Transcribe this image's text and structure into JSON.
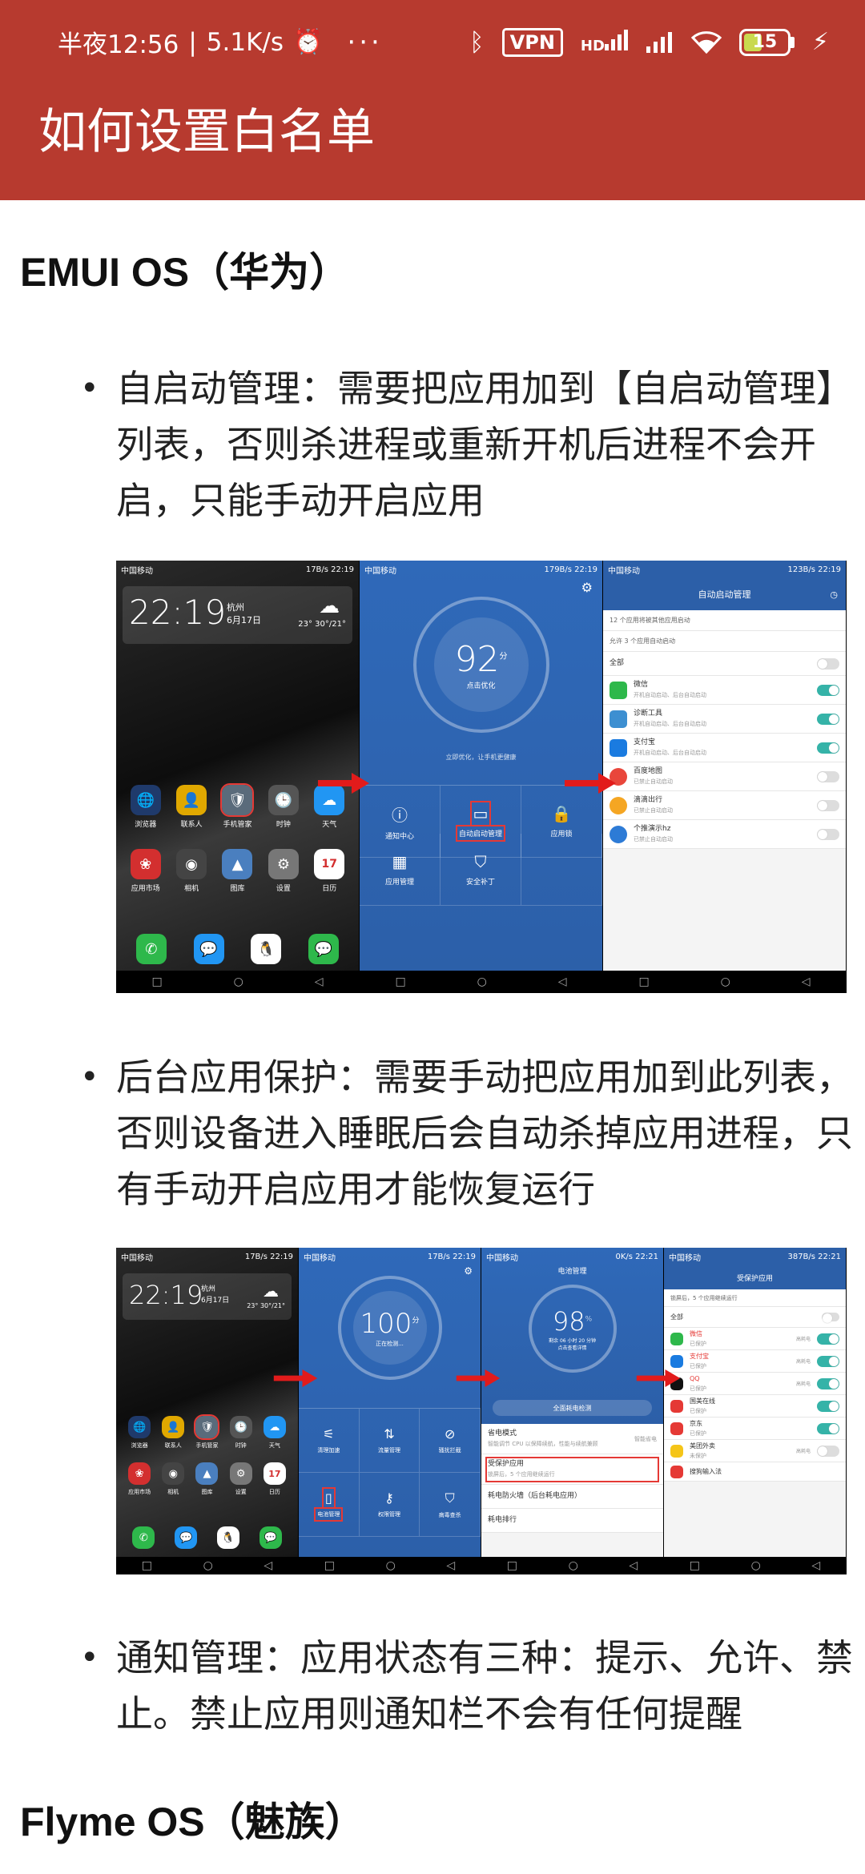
{
  "status_bar": {
    "time": "半夜12:56",
    "speed": "5.1K/s",
    "more": "···",
    "vpn": "VPN",
    "network": "HD",
    "battery": "15"
  },
  "app_bar": {
    "title": "如何设置白名单"
  },
  "sections": [
    {
      "heading": "EMUI OS（华为）"
    },
    {
      "heading": "Flyme OS（魅族）"
    }
  ],
  "bullets": [
    "自启动管理：需要把应用加到【自启动管理】列表，否则杀进程或重新开机后进程不会开启，只能手动开启应用",
    "后台应用保护：需要手动把应用加到此列表，否则设备进入睡眠后会自动杀掉应用进程，只有手动开启应用才能恢复运行",
    "通知管理：应用状态有三种：提示、允许、禁止。禁止应用则通知栏不会有任何提醒"
  ],
  "shot1": {
    "home": {
      "carrier": "中国移动",
      "status_right": "17B/s 22:19",
      "time": "22:19",
      "city": "杭州",
      "date": "6月17日",
      "temp": "23° 30°/21°",
      "apps_row1": [
        "浏览器",
        "联系人",
        "手机管家",
        "时钟",
        "天气"
      ],
      "apps_row2": [
        "应用市场",
        "相机",
        "图库",
        "设置",
        "日历"
      ]
    },
    "manager": {
      "carrier": "中国移动",
      "status_right": "179B/s 22:19",
      "score": "92",
      "score_unit": "分",
      "score_sub": "点击优化",
      "hint": "立即优化，让手机更健康",
      "cells": [
        "通知中心",
        "自动启动管理",
        "应用锁",
        "应用管理",
        "安全补丁"
      ]
    },
    "list": {
      "carrier": "中国移动",
      "status_right": "123B/s 22:19",
      "title": "自动启动管理",
      "info1": "12 个应用将被其他应用启动",
      "info2": "允许 3 个应用自动启动",
      "all": "全部",
      "rows": [
        {
          "name": "微信",
          "sub": "开机自动启动、后台自动启动",
          "on": true
        },
        {
          "name": "诊断工具",
          "sub": "开机自动启动、后台自动启动",
          "on": true
        },
        {
          "name": "支付宝",
          "sub": "开机自动启动、后台自动启动",
          "on": true
        },
        {
          "name": "百度地图",
          "sub": "已禁止自动启动",
          "on": false
        },
        {
          "name": "滴滴出行",
          "sub": "已禁止自动启动",
          "on": false
        },
        {
          "name": "个推演示hz",
          "sub": "已禁止自动启动",
          "on": false
        }
      ]
    }
  },
  "shot2": {
    "home": {
      "carrier": "中国移动",
      "status_right": "17B/s 22:19",
      "time": "22:19",
      "city": "杭州",
      "date": "6月17日",
      "temp": "23° 30°/21°",
      "apps_row1": [
        "浏览器",
        "联系人",
        "手机管家",
        "时钟",
        "天气"
      ],
      "apps_row2": [
        "应用市场",
        "相机",
        "图库",
        "设置",
        "日历"
      ]
    },
    "manager": {
      "carrier": "中国移动",
      "status_right": "17B/s 22:19",
      "score": "100",
      "score_unit": "分",
      "score_sub": "正在检测...",
      "cells": [
        "清理加速",
        "流量管理",
        "骚扰拦截",
        "电池管理",
        "权限管理",
        "病毒查杀"
      ]
    },
    "battery": {
      "carrier": "中国移动",
      "status_right": "0K/s 22:21",
      "title": "电池管理",
      "score": "98",
      "score_unit": "%",
      "score_sub": "剩余 06 小时 20 分钟",
      "score_sub2": "点击查看详情",
      "button": "全面耗电检测",
      "rows": [
        {
          "name": "省电模式",
          "sub": "智能调节 CPU 以保障续航，性能与续航兼顾",
          "side": "智能省电"
        },
        {
          "name": "受保护应用",
          "sub": "锁屏后，5 个应用继续运行",
          "side": ""
        },
        {
          "name": "耗电防火墙（后台耗电应用）",
          "sub": "",
          "side": ""
        },
        {
          "name": "耗电排行",
          "sub": "",
          "side": ""
        }
      ]
    },
    "protect": {
      "carrier": "中国移动",
      "status_right": "387B/s 22:21",
      "title": "受保护应用",
      "info": "锁屏后，5 个应用继续运行",
      "all": "全部",
      "rows": [
        {
          "name": "微信",
          "sub": "已保护",
          "side": "高耗电",
          "on": true
        },
        {
          "name": "支付宝",
          "sub": "已保护",
          "side": "高耗电",
          "on": true
        },
        {
          "name": "QQ",
          "sub": "已保护",
          "side": "高耗电",
          "on": true
        },
        {
          "name": "国美在线",
          "sub": "已保护",
          "side": "",
          "on": true
        },
        {
          "name": "京东",
          "sub": "已保护",
          "side": "",
          "on": true
        },
        {
          "name": "美团外卖",
          "sub": "未保护",
          "side": "高耗电",
          "on": false
        },
        {
          "name": "搜狗输入法",
          "sub": "未保护",
          "side": "",
          "on": false
        }
      ]
    }
  },
  "colors": {
    "app_bar": "#b73a2f",
    "toggle_on": "#35b3a8",
    "arrow": "#e21b1b",
    "manager_blue": "#2f69b9"
  }
}
